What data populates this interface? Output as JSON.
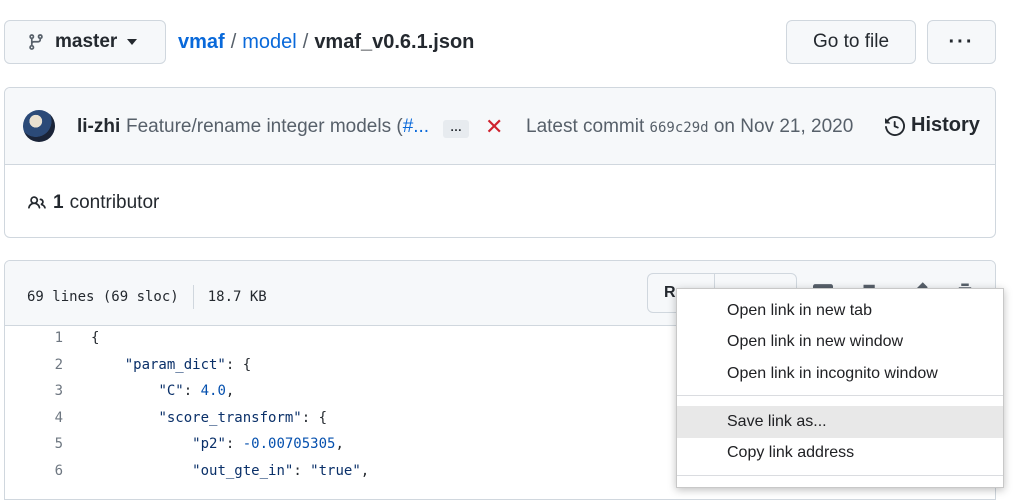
{
  "header": {
    "branch": "master",
    "breadcrumb": {
      "repo": "vmaf",
      "separator": "/",
      "folder": "model",
      "file": "vmaf_v0.6.1.json"
    },
    "go_to_file": "Go to file",
    "more_label": "···"
  },
  "commit": {
    "author": "li-zhi",
    "message": "Feature/rename integer models (",
    "message_link": "#...",
    "ellipsis": "…",
    "status_icon": "x-icon",
    "latest_label": "Latest commit",
    "sha": "669c29d",
    "date_text": "on Nov 21, 2020",
    "history": "History"
  },
  "contributors": {
    "count": "1",
    "label": "contributor"
  },
  "file": {
    "lines": "69 lines (69 sloc)",
    "size": "18.7 KB",
    "raw_visible": "R",
    "code": [
      {
        "n": "1",
        "indent": "",
        "parts": [
          [
            "p",
            "{"
          ]
        ]
      },
      {
        "n": "2",
        "indent": "    ",
        "parts": [
          [
            "k",
            "\"param_dict\""
          ],
          [
            "p",
            ": {"
          ]
        ]
      },
      {
        "n": "3",
        "indent": "        ",
        "parts": [
          [
            "k",
            "\"C\""
          ],
          [
            "p",
            ": "
          ],
          [
            "v",
            "4.0"
          ],
          [
            "p",
            ","
          ]
        ]
      },
      {
        "n": "4",
        "indent": "        ",
        "parts": [
          [
            "k",
            "\"score_transform\""
          ],
          [
            "p",
            ": {"
          ]
        ]
      },
      {
        "n": "5",
        "indent": "            ",
        "parts": [
          [
            "k",
            "\"p2\""
          ],
          [
            "p",
            ": "
          ],
          [
            "v",
            "-0.00705305"
          ],
          [
            "p",
            ","
          ]
        ]
      },
      {
        "n": "6",
        "indent": "            ",
        "parts": [
          [
            "k",
            "\"out_gte_in\""
          ],
          [
            "p",
            ": "
          ],
          [
            "k",
            "\"true\""
          ],
          [
            "p",
            ","
          ]
        ]
      }
    ]
  },
  "context_menu": {
    "items": [
      "Open link in new tab",
      "Open link in new window",
      "Open link in incognito window",
      "Save link as...",
      "Copy link address"
    ],
    "hovered_index": 3
  },
  "colors": {
    "link": "#0969da",
    "error": "#cf222e",
    "border": "#d0d7de"
  }
}
